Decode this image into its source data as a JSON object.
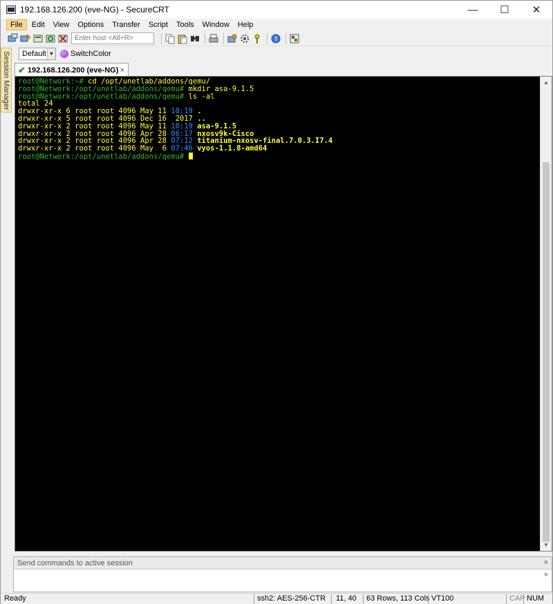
{
  "window": {
    "title": "192.168.126.200 (eve-NG) - SecureCRT",
    "minimize": "—",
    "maximize": "☐",
    "close": "✕"
  },
  "menu": {
    "items": [
      "File",
      "Edit",
      "View",
      "Options",
      "Transfer",
      "Script",
      "Tools",
      "Window",
      "Help"
    ]
  },
  "toolbar": {
    "host_placeholder": "Enter host <Alt+R>",
    "icons": [
      "connect-icon",
      "quick-connect-icon",
      "connect-tab-icon",
      "reconnect-icon",
      "disconnect-icon",
      "copy-icon",
      "paste-icon",
      "find-icon",
      "print-icon",
      "session-options-icon",
      "global-options-icon",
      "keymap-icon",
      "help-icon",
      "sftp-icon"
    ]
  },
  "buttonbar": {
    "select_value": "Default",
    "switch_label": "SwitchColor"
  },
  "session_manager": {
    "label": "Session Manager"
  },
  "tab": {
    "label": "192.168.126.200 (eve-NG)",
    "close": "×"
  },
  "terminal": {
    "prompt_home": "root@Network:~#",
    "cmd1": " cd /opt/unetlab/addons/qemu/",
    "prompt_qemu": "root@Network:/opt/unetlab/addons/qemu#",
    "cmd2": " mkdir asa-9.1.5",
    "cmd3": " ls -al",
    "total": "total 24",
    "listing": [
      {
        "perm": "drwxr-xr-x 6 root root 4096 May 11 ",
        "time": "10:19",
        "name": " ."
      },
      {
        "perm": "drwxr-xr-x 5 root root 4096 Dec 16  ",
        "time": "2017",
        "name": " .."
      },
      {
        "perm": "drwxr-xr-x 2 root root 4096 May 11 ",
        "time": "10:19",
        "name": " asa-9.1.5"
      },
      {
        "perm": "drwxr-xr-x 2 root root 4096 Apr 28 ",
        "time": "06:17",
        "name": " nxosv9k-Cisco"
      },
      {
        "perm": "drwxr-xr-x 2 root root 4096 Apr 28 ",
        "time": "07:12",
        "name": " titanium-nxosv-final.7.0.3.I7.4"
      },
      {
        "perm": "drwxr-xr-x 2 root root 4096 May  6 ",
        "time": "07:46",
        "name": " vyos-1.1.8-amd64"
      }
    ]
  },
  "command_window": {
    "header": "Send commands to active session",
    "close": "×"
  },
  "status": {
    "ready": "Ready",
    "cipher": "ssh2: AES-256-CTR",
    "position": "11, 40",
    "size": "63 Rows, 113 Cols",
    "terminal_type": "VT100",
    "cap": "CAP",
    "num": "NUM"
  }
}
